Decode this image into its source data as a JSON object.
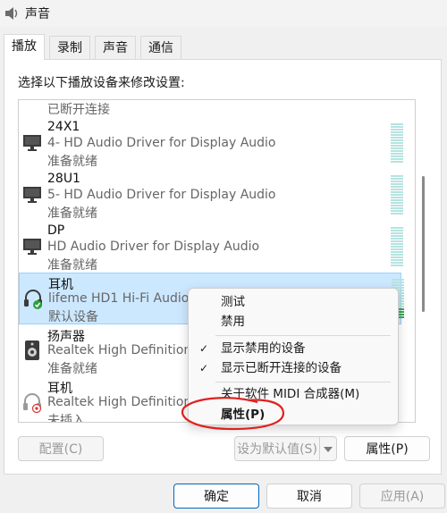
{
  "window": {
    "title": "声音"
  },
  "tabs": [
    "播放",
    "录制",
    "声音",
    "通信"
  ],
  "panel": {
    "label": "选择以下播放设备来修改设置:"
  },
  "devices": [
    {
      "name": "",
      "desc": "",
      "status": "已断开连接",
      "icon": "monitor-icon"
    },
    {
      "name": "24X1",
      "desc": "4- HD Audio Driver for Display Audio",
      "status": "准备就绪",
      "icon": "monitor-icon"
    },
    {
      "name": "28U1",
      "desc": "5- HD Audio Driver for Display Audio",
      "status": "准备就绪",
      "icon": "monitor-icon"
    },
    {
      "name": "DP",
      "desc": "HD Audio Driver for Display Audio",
      "status": "准备就绪",
      "icon": "monitor-icon"
    },
    {
      "name": "耳机",
      "desc": "lifeme HD1 Hi-Fi Audio Bo",
      "status": "默认设备",
      "icon": "headphones-default-icon",
      "selected": true
    },
    {
      "name": "扬声器",
      "desc": "Realtek High Definition A",
      "status": "准备就绪",
      "icon": "speaker-icon"
    },
    {
      "name": "耳机",
      "desc": "Realtek High Definition A",
      "status": "未插入",
      "icon": "headphones-unplugged-icon"
    }
  ],
  "context_menu": {
    "items": [
      {
        "label": "测试",
        "checked": false
      },
      {
        "label": "禁用",
        "checked": false
      },
      {
        "label": "显示禁用的设备",
        "checked": true
      },
      {
        "label": "显示已断开连接的设备",
        "checked": true
      },
      {
        "label": "关于软件 MIDI 合成器(M)",
        "checked": false
      },
      {
        "label": "属性(P)",
        "checked": false,
        "bold": true
      }
    ],
    "check_glyph": "✓"
  },
  "panel_buttons": {
    "configure": "配置(C)",
    "set_default": "设为默认值(S)",
    "properties": "属性(P)"
  },
  "dialog_buttons": {
    "ok": "确定",
    "cancel": "取消",
    "apply": "应用(A)"
  },
  "colors": {
    "selection": "#cce8ff",
    "accent": "#0067c0",
    "annotation": "#e0211d",
    "vu_meter": "#b6e3e0",
    "vu_active": "#3aa64f"
  },
  "vu_levels": {
    "selected_device_active_fraction": 0.27
  }
}
